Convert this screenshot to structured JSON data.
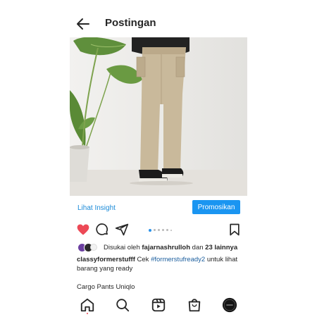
{
  "header": {
    "title": "Postingan",
    "back_icon": "arrow-left-icon"
  },
  "photo": {
    "subject": "photo-cargo-pants",
    "colors": {
      "wall": "#ececea",
      "floor": "#e2dfda",
      "pants": "#c8b89a",
      "sweater": "#1f1f1f",
      "leaf": "#5f8f3c"
    }
  },
  "insight": {
    "link_label": "Lihat Insight",
    "promo_label": "Promosikan"
  },
  "actions": {
    "liked": true,
    "icons": [
      "heart-filled-icon",
      "comment-icon",
      "send-icon",
      "bookmark-icon"
    ],
    "carousel": {
      "count": 6,
      "active_index": 0
    }
  },
  "likes": {
    "prefix": "Disukai oleh",
    "user": "fajarnashrulloh",
    "joiner": "dan",
    "others": "23 lainnya"
  },
  "caption": {
    "user": "classyformerstufff",
    "text_before": "Cek",
    "hashtag": "#formerstufready2",
    "text_after": "untuk lihat barang yang ready"
  },
  "post_title": "Cargo Pants Uniqlo",
  "nav": [
    "home-icon",
    "search-icon",
    "reels-icon",
    "shop-icon",
    "profile-avatar"
  ],
  "colors": {
    "accent": "#1a95f1",
    "link": "#1a8ad8",
    "heart": "#ed4956",
    "hashtag": "#1b5e9e"
  }
}
